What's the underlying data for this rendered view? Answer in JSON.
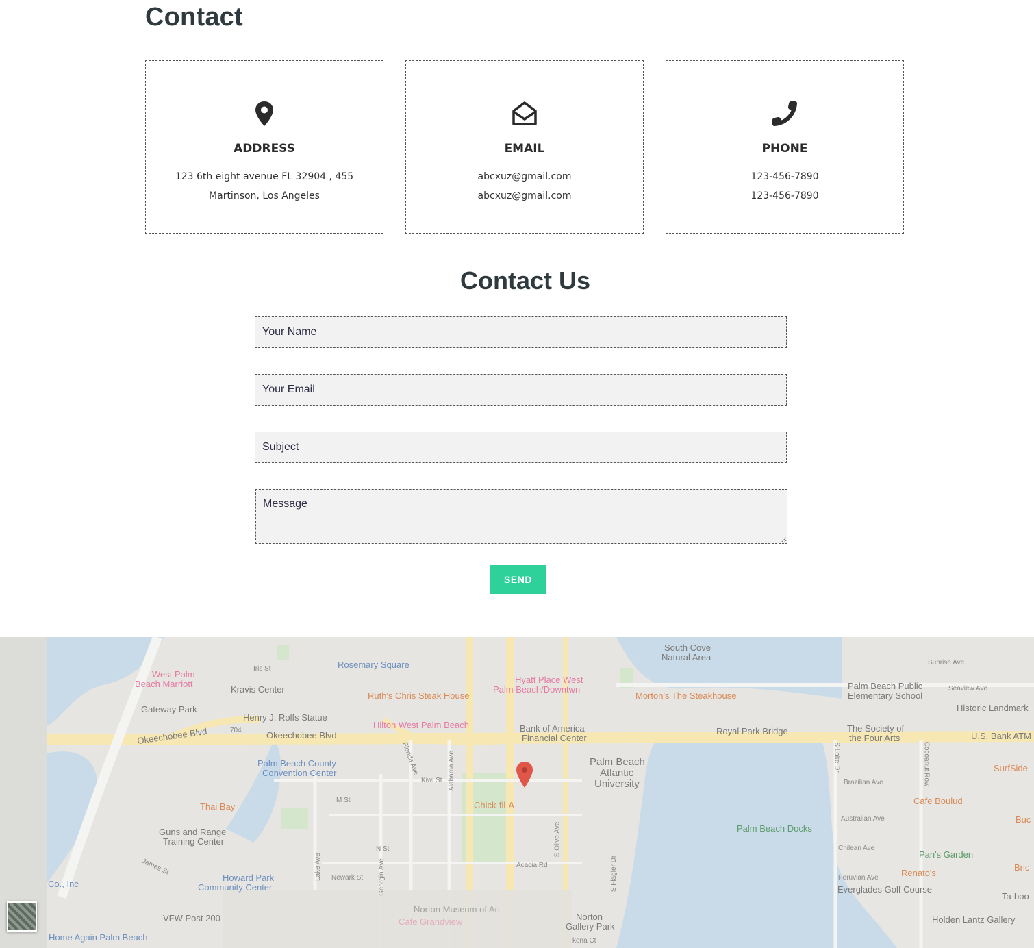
{
  "page": {
    "title": "Contact"
  },
  "cards": [
    {
      "label": "ADDRESS",
      "icon": "map-pin-icon",
      "line1": "123 6th eight avenue FL 32904 , 455",
      "line2": "Martinson, Los Angeles"
    },
    {
      "label": "EMAIL",
      "icon": "open-envelope-icon",
      "line1": "abcxuz@gmail.com",
      "line2": "abcxuz@gmail.com"
    },
    {
      "label": "PHONE",
      "icon": "phone-icon",
      "line1": "123-456-7890",
      "line2": "123-456-7890"
    }
  ],
  "form": {
    "title": "Contact Us",
    "name_placeholder": "Your Name",
    "email_placeholder": "Your Email",
    "subject_placeholder": "Subject",
    "message_placeholder": "Message",
    "send_label": "SEND"
  },
  "colors": {
    "accent": "#2ed19a",
    "heading": "#2f3a3f",
    "field_bg": "#f2f2f2",
    "water": "#c9dbe8",
    "road": "#f6e7b3"
  },
  "map": {
    "labels": [
      "South Cove",
      "Natural Area",
      "Rosemary Square",
      "Iris St",
      "West Palm",
      "Beach Marriott",
      "Kravis Center",
      "Ruth's Chris Steak House",
      "Hyatt Place West",
      "Palm Beach/Downtwn",
      "Morton's The Steakhouse",
      "Palm Beach Public",
      "Elementary School",
      "Historic Landmark",
      "Gateway Park",
      "Henry J. Rolfs Statue",
      "Hilton West Palm Beach",
      "Bank of America",
      "Financial Center",
      "Royal Park Bridge",
      "The Society of",
      "the Four Arts",
      "U.S. Bank ATM",
      "Okeechobee Blvd",
      "704",
      "Palm Beach County",
      "Convention Center",
      "Palm Beach",
      "Atlantic",
      "University",
      "SurfSide",
      "Thai Bay",
      "Kiwi St",
      "M St",
      "Chick-fil-A",
      "Cafe Boulud",
      "Guns and Range",
      "Training Center",
      "Palm Beach Docks",
      "Pan's Garden",
      "Renato's",
      "Howard Park",
      "Community Center",
      "Newark St",
      "Acacia Rd",
      "S Olive Ave",
      "Everglades Golf Course",
      "Co., Inc",
      "VFW Post 200",
      "Norton Museum of Art",
      "Norton",
      "Gallery Park",
      "Holden Lantz Gallery",
      "Home Again Palm Beach",
      "James St",
      "Florida Ave",
      "Alabama Ave",
      "Georgia Ave",
      "Lake Ave",
      "N St",
      "S Flagler Dr",
      "Brazilian Ave",
      "Australian Ave",
      "Chilean Ave",
      "Peruvian Ave",
      "S Lake Dr",
      "Cocoanut Row",
      "Sunrise Ave",
      "Seaview Ave",
      "Buc",
      "Bric",
      "Ta-boo",
      "Cafe Grandview",
      "Okeechobee Blvd",
      "kona Ct"
    ]
  }
}
